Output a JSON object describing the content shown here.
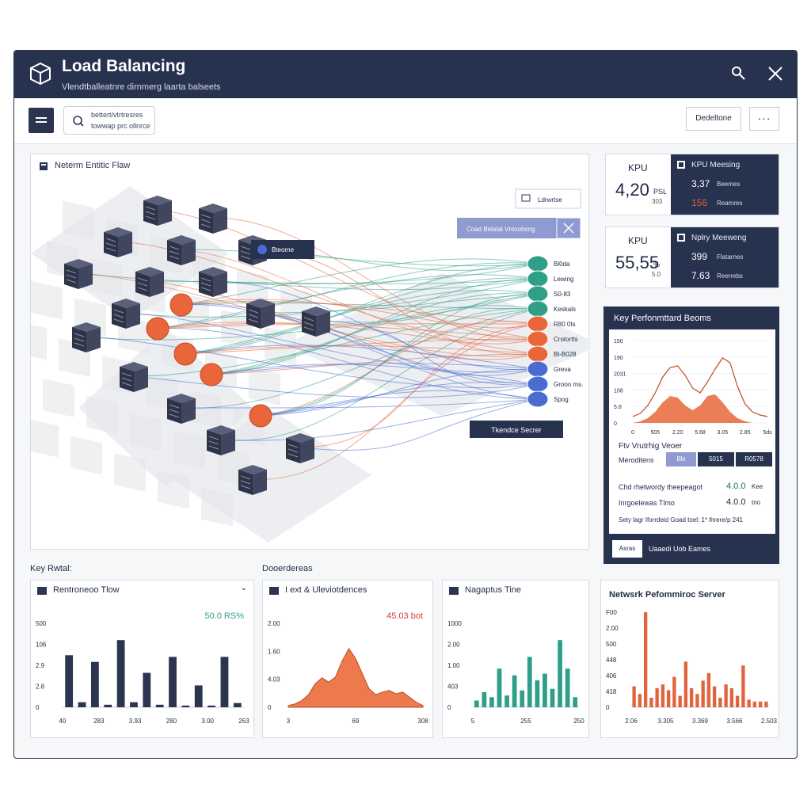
{
  "window": {
    "title": "Load Balancing",
    "subtitle": "Vlendtballeatnre dirnmerg laarta balseets"
  },
  "toolbar": {
    "search_line1": "bettert/vtrtresres",
    "search_line2": "towwap prc ollnrce",
    "dropdown_label": "Dedeltone",
    "more_label": "···"
  },
  "flow_panel": {
    "title": "Neterm Entitic Flaw",
    "legend_button": "Ldrwrtse",
    "selected_button": "Coad Belatal Vntoohong",
    "node_tooltip": "Bteorne",
    "target_label": "Tkendce Secrer",
    "server_labels": [
      "Bl0da",
      "Lewing",
      "S0-83",
      "Keskals",
      "R80 0ts",
      "Crotortts",
      "Bl-B028",
      "Greva",
      "Grooo ms.",
      "Spog"
    ]
  },
  "kpi_cards": [
    {
      "label": "KPU",
      "value": "4,20",
      "unit": "PSL",
      "sub": "303",
      "right_title": "KPU Meesing",
      "rows": [
        {
          "value": "3,37",
          "label": "Beemes",
          "color": "#ffffff"
        },
        {
          "value": "156",
          "label": "Reamres",
          "color": "#e05a3a"
        }
      ]
    },
    {
      "label": "KPU",
      "value": "55,55",
      "unit": "%",
      "sub": "5.0",
      "right_title": "Nplry Meeweng",
      "rows": [
        {
          "value": "399",
          "label": "Flatarnes",
          "color": "#ffffff"
        },
        {
          "value": "7.63",
          "label": "Reerrebs",
          "color": "#ffffff"
        }
      ]
    }
  ],
  "kpf_panel": {
    "title": "Key Perfonmttard Beoms",
    "chart_ticks_y": [
      "150",
      "190",
      "2031",
      "108",
      "5.8",
      "0"
    ],
    "chart_ticks_x": [
      "0",
      "505",
      "2.20",
      "5.68",
      "3.05",
      "2.85",
      "5ds"
    ],
    "subtitle": "Ftv Vrutrhig Veoer",
    "metric_label": "Meroditens",
    "buttons": [
      "Bls",
      "5015",
      "R0578"
    ],
    "rows": [
      {
        "label": "Chd rhetwordy theepeagot",
        "value": "4.0.0",
        "suffix": "Kee",
        "color": "#1f6f6a"
      },
      {
        "label": "Inrgoelewas Tlmo",
        "value": "4.0.0",
        "suffix": "tno",
        "color": "#1f2a44"
      }
    ],
    "foot": "Sety lagr Iforrdeid Goad  toel: 1* lhrere/p 241",
    "bottom_button": "Asras",
    "bottom_text": "Uaaedi Uob Eames"
  },
  "section_labels": {
    "left": "Key Rwtal:",
    "mid": "Dooerdereas"
  },
  "chart_data": [
    {
      "type": "bar",
      "title": "Rentroneoo Tlow",
      "annotation": "50.0 RS%",
      "yticks": [
        "500",
        "106",
        "2.9",
        "2.8",
        "0"
      ],
      "xticks": [
        "40",
        "283",
        "3.93",
        "280",
        "3.00",
        "263"
      ],
      "ylim": [
        0,
        100
      ],
      "values": [
        62,
        6,
        54,
        3,
        80,
        6,
        41,
        3,
        60,
        2,
        26,
        2,
        60,
        5
      ]
    },
    {
      "type": "area",
      "title": "I ext & Uleviotdences",
      "annotation": "45.03 bot",
      "yticks": [
        "2.00",
        "1.60",
        "4.03",
        "0"
      ],
      "xticks": [
        "3",
        "69",
        "308"
      ],
      "ylim": [
        0,
        100
      ],
      "values": [
        2,
        4,
        8,
        15,
        28,
        35,
        30,
        36,
        55,
        70,
        58,
        40,
        22,
        15,
        18,
        20,
        16,
        18,
        12,
        6,
        2
      ]
    },
    {
      "type": "bar",
      "title": "Nagaptus Tine",
      "yticks": [
        "1000",
        "2.00",
        "1.00",
        "403",
        "0"
      ],
      "xticks": [
        "5",
        "255",
        "250"
      ],
      "ylim": [
        0,
        100
      ],
      "values": [
        8,
        18,
        12,
        46,
        14,
        38,
        20,
        60,
        32,
        40,
        22,
        80,
        46,
        12
      ]
    },
    {
      "type": "bar",
      "title": "Netwsrk Pefommiroc Server",
      "yticks": [
        "F00",
        "2.00",
        "500",
        "448",
        "406",
        "418",
        "0"
      ],
      "xticks": [
        "2.06",
        "3.305",
        "3.369",
        "3.566",
        "2.503"
      ],
      "ylim": [
        0,
        100
      ],
      "values": [
        22,
        14,
        100,
        10,
        20,
        24,
        18,
        32,
        12,
        48,
        20,
        14,
        28,
        36,
        22,
        10,
        24,
        20,
        12,
        44,
        8,
        6,
        6,
        6
      ]
    }
  ],
  "colors": {
    "navy": "#27324f",
    "teal": "#2f9f8a",
    "orange": "#e8663a",
    "blue": "#4a6bd0",
    "red": "#d93b3b"
  }
}
